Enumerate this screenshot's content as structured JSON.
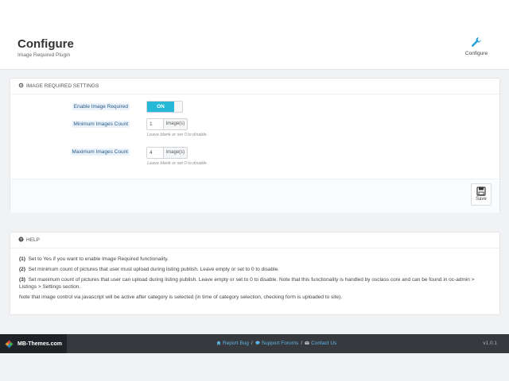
{
  "header": {
    "title": "Configure",
    "subtitle": "Image Required Plugin",
    "configure_label": "Configure",
    "configure_icon": "wrench-icon"
  },
  "settings": {
    "heading": "IMAGE REQUIRED SETTINGS",
    "heading_icon": "gear-icon",
    "enable_label": "Enable Image Required",
    "enable_toggle": "ON",
    "min_label": "Minimum Images Count",
    "min_value": "1",
    "min_addon": "image(s)",
    "min_hint": "Leave blank or set 0 to disable.",
    "max_label": "Maximum Images Count",
    "max_value": "4",
    "max_addon": "image(s)",
    "max_hint": "Leave blank or set 0 to disable.",
    "save_label": "Save",
    "save_icon": "floppy-disk-icon"
  },
  "help": {
    "heading": "HELP",
    "heading_icon": "question-circle-icon",
    "items": [
      {
        "num": "(1)",
        "text": "Set to Yes if you want to enable Image Required functionality."
      },
      {
        "num": "(2)",
        "text": "Set minimum count of pictures that user must upload during listing publish. Leave empty or set to 0 to disable."
      },
      {
        "num": "(3)",
        "text": "Set maximum count of pictures that user can upload during listing publish. Leave empty or set to 0 to disable. Note that this functionality is handled by osclass core and can be found in oc-admin > Listings > Settings section."
      }
    ],
    "note": "Note that image control via javascript will be active after category is selected (in time of category selection, checking form is uploaded to site)."
  },
  "footer": {
    "brand": "MB-Themes.com",
    "report_bug": "Report Bug",
    "support_forums": "Support Forums",
    "contact_us": "Contact Us",
    "separator": "/",
    "version": "v1.0.1",
    "accent": "#5fb3e6"
  },
  "colors": {
    "toggle_on": "#25b9d7",
    "page_bg": "#f1f2f4"
  }
}
